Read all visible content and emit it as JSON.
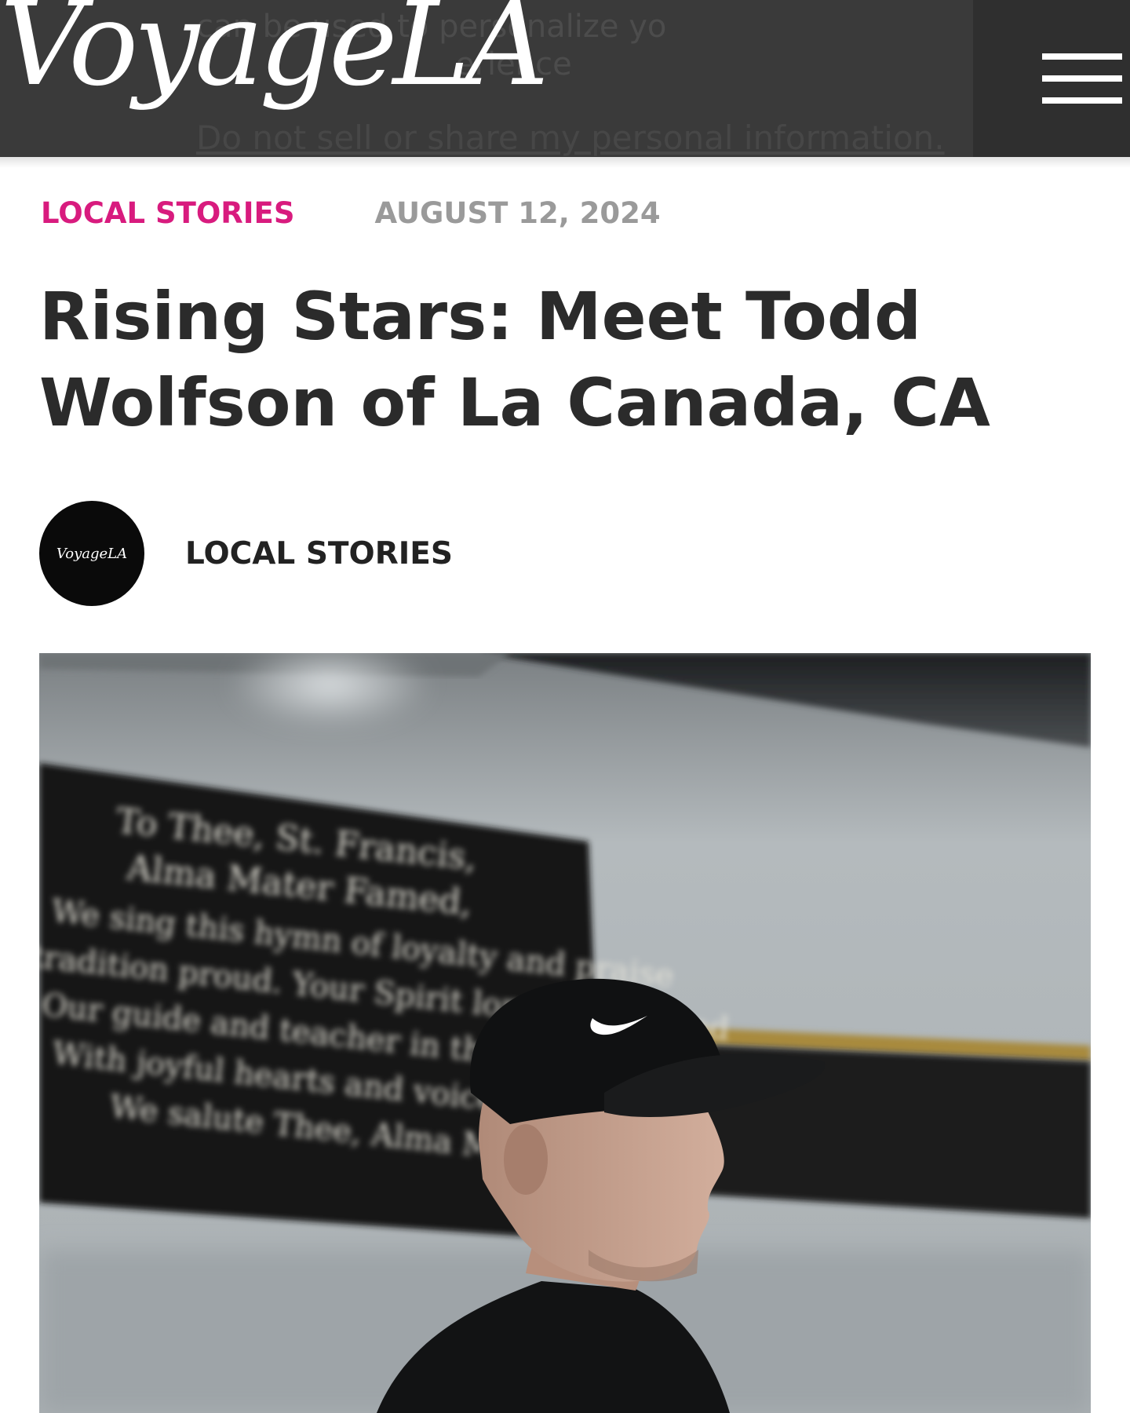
{
  "header": {
    "logo_text": "VoyageLA",
    "consent_overlay": {
      "line1": "can be used to personalize yo",
      "line2": "erience",
      "link": "Do not sell or share my personal information."
    },
    "menu_icon": "hamburger-menu-icon"
  },
  "article": {
    "category": "LOCAL STORIES",
    "date": "AUGUST 12, 2024",
    "title": "Rising Stars: Meet Todd Wolfson of La Canada, CA",
    "author": {
      "avatar_text": "VoyageLA",
      "name": "LOCAL STORIES"
    },
    "hero_image": {
      "banner_lines": [
        "To Thee, St. Francis,",
        "Alma Mater Famed,",
        "We sing this hymn of loyalty and praise",
        "tradition proud. Your Spirit long proclaimed",
        "Our guide and teacher in the way of",
        "With joyful hearts and voices in",
        "We salute Thee, Alma Mat"
      ]
    }
  },
  "colors": {
    "header_bg": "#3a3a3a",
    "category": "#d81b7e",
    "date": "#9a9a9a",
    "title": "#2b2b2b"
  }
}
